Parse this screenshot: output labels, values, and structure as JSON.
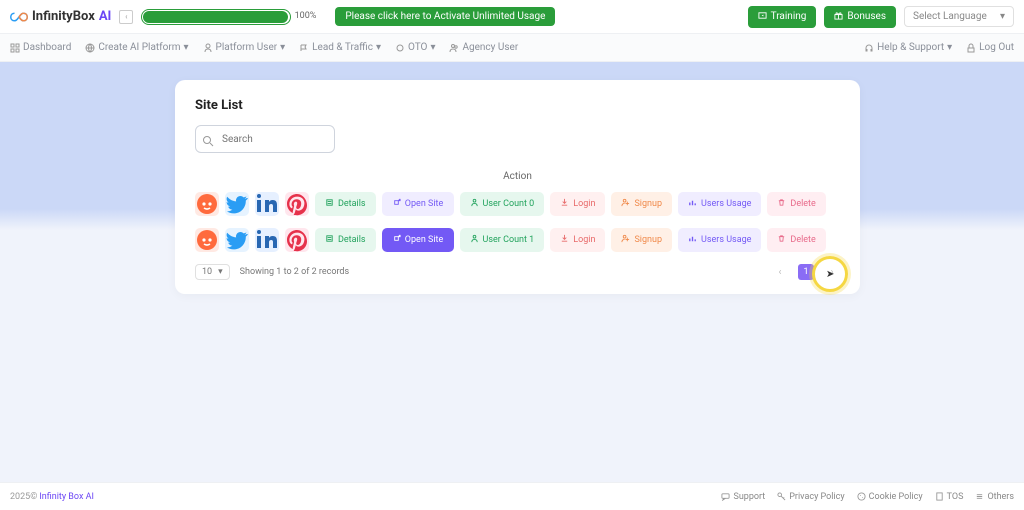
{
  "header": {
    "brand_name": "InfinityBox",
    "brand_suffix": "AI",
    "progress_pct": "100%",
    "activate_label": "Please click here to Activate Unlimited Usage",
    "training_label": "Training",
    "bonuses_label": "Bonuses",
    "lang_label": "Select Language"
  },
  "menu": {
    "dashboard": "Dashboard",
    "create_ai": "Create AI Platform",
    "platform_user": "Platform User",
    "lead_traffic": "Lead & Traffic",
    "oto": "OTO",
    "agency_user": "Agency User",
    "help_support": "Help & Support",
    "logout": "Log Out"
  },
  "card": {
    "title": "Site List",
    "search_placeholder": "Search",
    "action_header": "Action",
    "rows": [
      {
        "details": "Details",
        "open": "Open Site",
        "open_active": false,
        "usercount": "User Count 0",
        "login": "Login",
        "signup": "Signup",
        "usersusage": "Users Usage",
        "delete": "Delete"
      },
      {
        "details": "Details",
        "open": "Open Site",
        "open_active": true,
        "usercount": "User Count 1",
        "login": "Login",
        "signup": "Signup",
        "usersusage": "Users Usage",
        "delete": "Delete"
      }
    ],
    "perpage": "10",
    "showing": "Showing 1 to 2 of 2 records",
    "page": "1"
  },
  "footer": {
    "year": "2025©",
    "brand": "Infinity Box AI",
    "support": "Support",
    "privacy": "Privacy Policy",
    "cookie": "Cookie Policy",
    "tos": "TOS",
    "others": "Others"
  }
}
